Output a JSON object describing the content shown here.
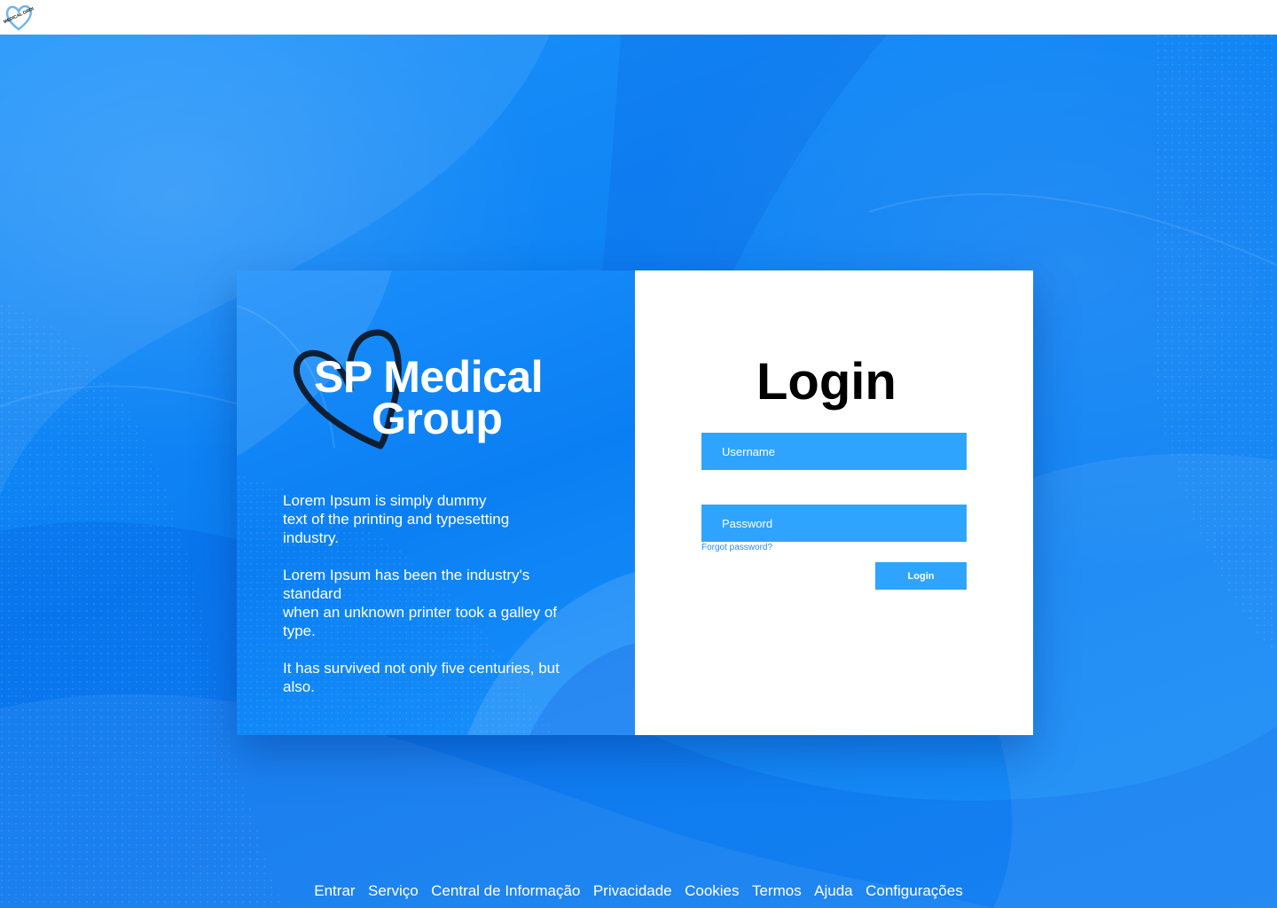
{
  "topbar": {
    "logo_text": "SP MEDICAL GROUP"
  },
  "brand": {
    "line1": "SP Medical",
    "line2": "Group"
  },
  "description": {
    "paragraphs": [
      "Lorem Ipsum is simply dummy\ntext of the printing and typesetting\nindustry.",
      " Lorem Ipsum has been the industry's\nstandard\nwhen an unknown printer took a galley of\ntype.",
      " It has survived not only five centuries, but\nalso."
    ]
  },
  "login": {
    "title": "Login",
    "username_placeholder": "Username",
    "password_placeholder": "Password",
    "forgot_label": "Forgot password?",
    "button_label": "Login"
  },
  "footer": {
    "links": [
      "Entrar",
      "Serviço",
      "Central de Informação",
      "Privacidade",
      "Cookies",
      "Termos",
      "Ajuda",
      "Configurações"
    ]
  },
  "colors": {
    "background": "#0a84f5",
    "field": "#2ea4ff",
    "link": "#1b8ff8",
    "heart_outline": "#0f1f33"
  },
  "icons": {
    "topbar_logo": "heart-logo-icon",
    "brand_logo": "heart-outline-icon"
  }
}
